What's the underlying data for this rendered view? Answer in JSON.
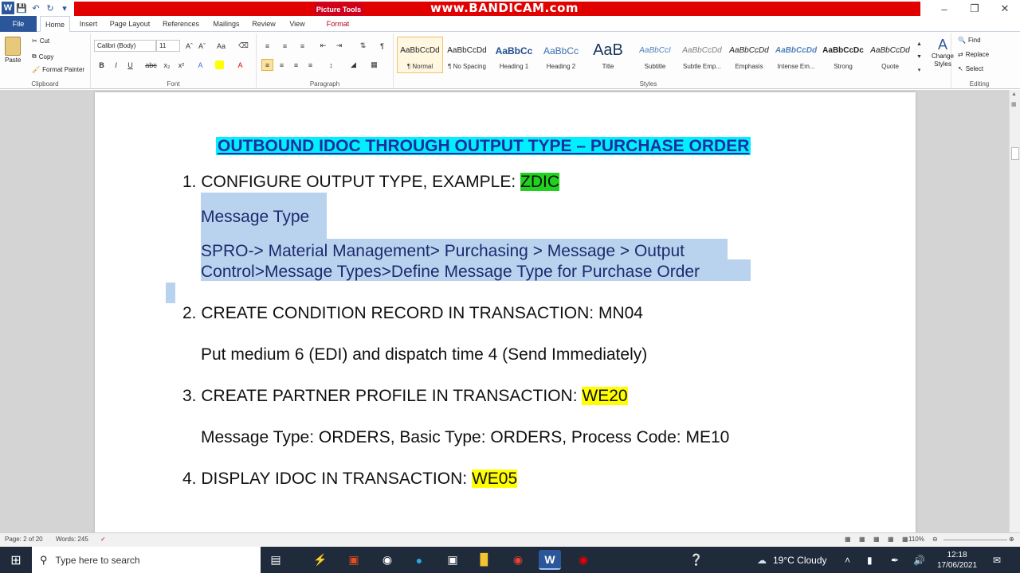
{
  "app": {
    "picture_tools_label": "Picture Tools",
    "recorder_watermark": "www.BANDICAM.com",
    "window_controls": {
      "minimize": "–",
      "maximize": "❐",
      "close": "✕"
    }
  },
  "tabs": [
    {
      "label": "File"
    },
    {
      "label": "Home"
    },
    {
      "label": "Insert"
    },
    {
      "label": "Page Layout"
    },
    {
      "label": "References"
    },
    {
      "label": "Mailings"
    },
    {
      "label": "Review"
    },
    {
      "label": "View"
    },
    {
      "label": "Format"
    }
  ],
  "ribbon": {
    "clipboard": {
      "paste": "Paste",
      "cut": "Cut",
      "copy": "Copy",
      "format_painter": "Format Painter",
      "label": "Clipboard"
    },
    "font": {
      "name": "Calibri (Body)",
      "size": "11",
      "label": "Font"
    },
    "paragraph": {
      "label": "Paragraph"
    },
    "styles": {
      "label": "Styles",
      "items": [
        {
          "preview": "AaBbCcDd",
          "name": "¶ Normal"
        },
        {
          "preview": "AaBbCcDd",
          "name": "¶ No Spacing"
        },
        {
          "preview": "AaBbCc",
          "name": "Heading 1"
        },
        {
          "preview": "AaBbCc",
          "name": "Heading 2"
        },
        {
          "preview": "AaB",
          "name": "Title"
        },
        {
          "preview": "AaBbCcI",
          "name": "Subtitle"
        },
        {
          "preview": "AaBbCcDd",
          "name": "Subtle Emp..."
        },
        {
          "preview": "AaBbCcDd",
          "name": "Emphasis"
        },
        {
          "preview": "AaBbCcDd",
          "name": "Intense Em..."
        },
        {
          "preview": "AaBbCcDc",
          "name": "Strong"
        },
        {
          "preview": "AaBbCcDd",
          "name": "Quote"
        }
      ],
      "change_styles": "Change Styles"
    },
    "editing": {
      "find": "Find",
      "replace": "Replace",
      "select": "Select",
      "label": "Editing"
    }
  },
  "document": {
    "title": "OUTBOUND IDOC THROUGH OUTPUT TYPE – PURCHASE ORDER",
    "step1": {
      "num": "1.",
      "text": "CONFIGURE OUTPUT TYPE, EXAMPLE: ",
      "code": "ZDIC"
    },
    "step1_sub1": "Message Type",
    "step1_sub2_line1": "SPRO-> Material Management> Purchasing > Message > Output",
    "step1_sub2_line2": "Control>Message Types>Define Message Type for Purchase Order",
    "step2": {
      "num": "2.",
      "text": "CREATE CONDITION RECORD IN TRANSACTION: MN04"
    },
    "step2_sub": "Put medium 6 (EDI) and dispatch time 4 (Send Immediately)",
    "step3": {
      "num": "3.",
      "text": "CREATE PARTNER PROFILE IN TRANSACTION: ",
      "code": "WE20"
    },
    "step3_sub": "Message Type: ORDERS, Basic Type: ORDERS, Process Code: ME10",
    "step4": {
      "num": "4.",
      "text": "DISPLAY IDOC IN TRANSACTION: ",
      "code": "WE05"
    }
  },
  "statusbar": {
    "page": "Page: 2 of 20",
    "words": "Words: 245",
    "zoom": "110%"
  },
  "taskbar": {
    "search_placeholder": "Type here to search",
    "weather": "19°C  Cloudy",
    "time": "12:18",
    "date": "17/06/2021"
  }
}
